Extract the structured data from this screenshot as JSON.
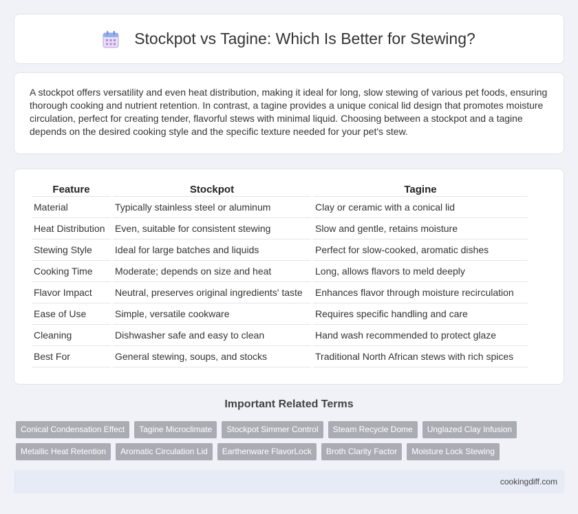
{
  "header": {
    "icon": "calendar-icon",
    "title": "Stockpot vs Tagine: Which Is Better for Stewing?"
  },
  "intro": {
    "text": "A stockpot offers versatility and even heat distribution, making it ideal for long, slow stewing of various pet foods, ensuring thorough cooking and nutrient retention. In contrast, a tagine provides a unique conical lid design that promotes moisture circulation, perfect for creating tender, flavorful stews with minimal liquid. Choosing between a stockpot and a tagine depends on the desired cooking style and the specific texture needed for your pet's stew."
  },
  "table": {
    "headers": [
      "Feature",
      "Stockpot",
      "Tagine"
    ],
    "rows": [
      [
        "Material",
        "Typically stainless steel or aluminum",
        "Clay or ceramic with a conical lid"
      ],
      [
        "Heat Distribution",
        "Even, suitable for consistent stewing",
        "Slow and gentle, retains moisture"
      ],
      [
        "Stewing Style",
        "Ideal for large batches and liquids",
        "Perfect for slow-cooked, aromatic dishes"
      ],
      [
        "Cooking Time",
        "Moderate; depends on size and heat",
        "Long, allows flavors to meld deeply"
      ],
      [
        "Flavor Impact",
        "Neutral, preserves original ingredients' taste",
        "Enhances flavor through moisture recirculation"
      ],
      [
        "Ease of Use",
        "Simple, versatile cookware",
        "Requires specific handling and care"
      ],
      [
        "Cleaning",
        "Dishwasher safe and easy to clean",
        "Hand wash recommended to protect glaze"
      ],
      [
        "Best For",
        "General stewing, soups, and stocks",
        "Traditional North African stews with rich spices"
      ]
    ]
  },
  "related": {
    "title": "Important Related Terms",
    "rows": [
      [
        "Conical Condensation Effect",
        "Tagine Microclimate",
        "Stockpot Simmer Control",
        "Steam Recycle Dome",
        "Unglazed Clay Infusion"
      ],
      [
        "Metallic Heat Retention",
        "Aromatic Circulation Lid",
        "Earthenware FlavorLock",
        "Broth Clarity Factor",
        "Moisture Lock Stewing"
      ]
    ]
  },
  "footer": {
    "text": "cookingdiff.com"
  }
}
